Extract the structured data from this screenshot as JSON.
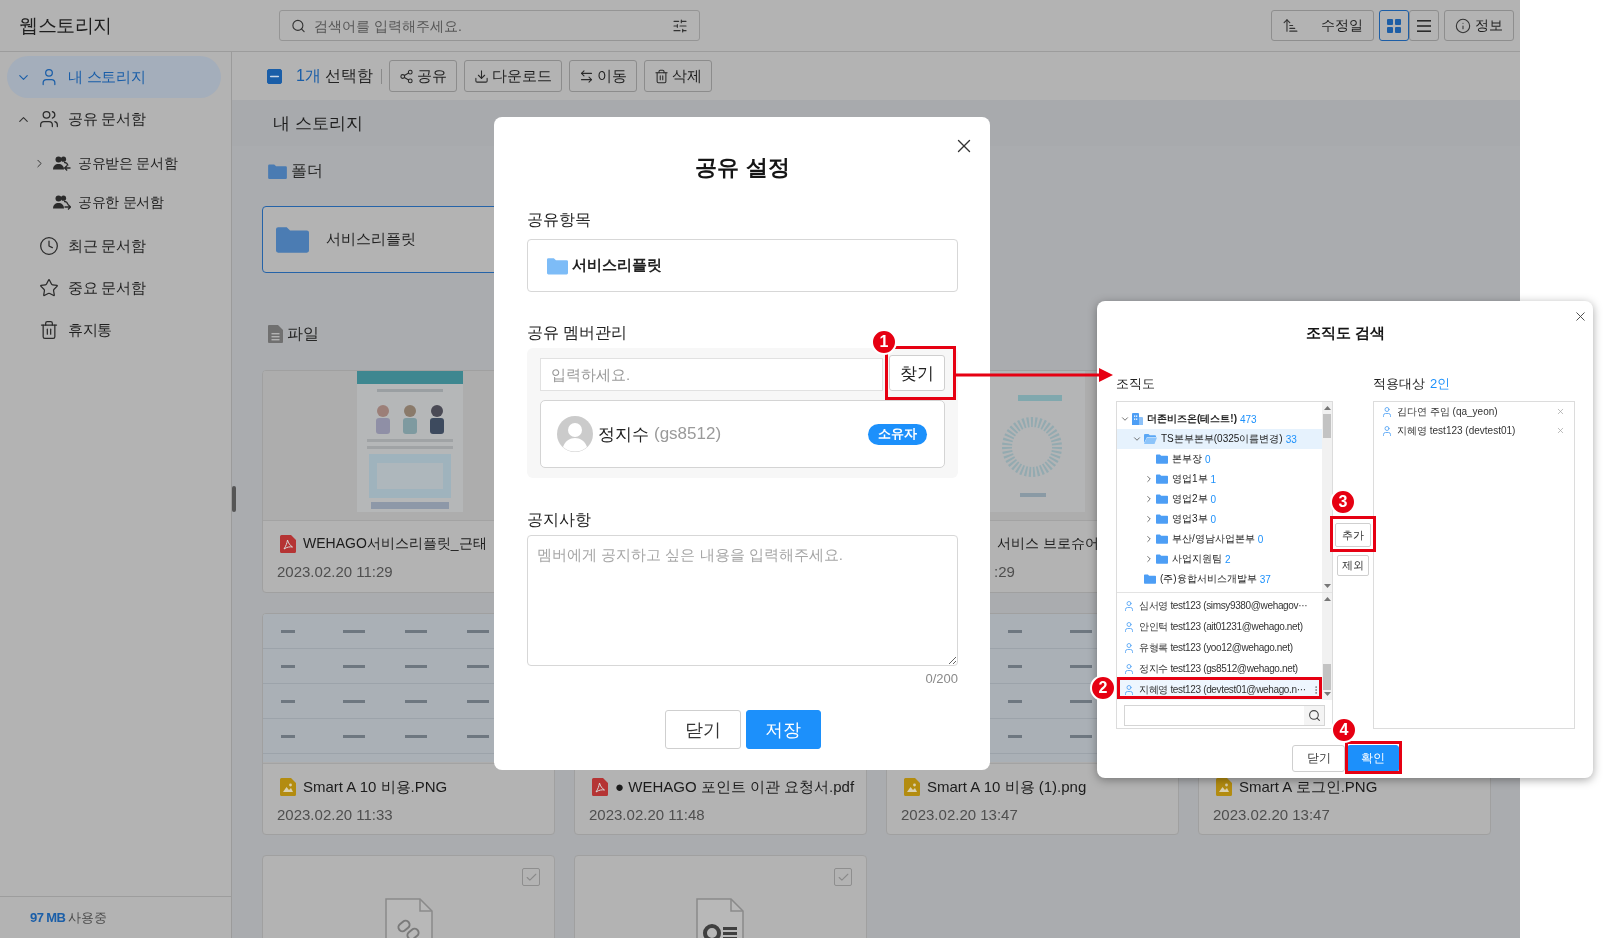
{
  "header": {
    "logo": "웹스토리지",
    "search": {
      "placeholder": "검색어를 입력해주세요."
    },
    "sort": {
      "label": "수정일"
    },
    "view_modes": [
      {
        "kind": "grid",
        "selected": true
      },
      {
        "kind": "list",
        "selected": false
      }
    ],
    "info": {
      "label": "정보"
    }
  },
  "sidebar": {
    "items": [
      {
        "kind": "storage",
        "label": "내 스토리지",
        "selected": true,
        "expanded": false
      },
      {
        "kind": "shared",
        "label": "공유 문서함",
        "selected": false,
        "expanded": true,
        "children": [
          {
            "kind": "received",
            "label": "공유받은 문서함",
            "selected": false,
            "expanded": false
          },
          {
            "kind": "sent",
            "label": "공유한 문서함",
            "selected": false
          }
        ]
      },
      {
        "kind": "recent",
        "label": "최근 문서함",
        "selected": false
      },
      {
        "kind": "important",
        "label": "중요 문서함",
        "selected": false
      },
      {
        "kind": "trash",
        "label": "휴지통",
        "selected": false
      }
    ],
    "usage": {
      "amount": "97 MB",
      "label": "사용중"
    }
  },
  "toolbar": {
    "selection": {
      "indeterminate": true,
      "count": "1개",
      "label": "선택함"
    },
    "actions": [
      {
        "kind": "share",
        "label": "공유"
      },
      {
        "kind": "download",
        "label": "다운로드"
      },
      {
        "kind": "move",
        "label": "이동"
      },
      {
        "kind": "delete",
        "label": "삭제"
      }
    ]
  },
  "breadcrumb": "내 스토리지",
  "folders": {
    "title": "폴더",
    "items": [
      {
        "name": "서비스리플릿",
        "selected": true
      }
    ]
  },
  "files": {
    "title": "파일",
    "items": [
      {
        "kind": "pdf",
        "name": "WEHAGO서비스리플릿_근태",
        "date": "2023.02.20 11:29"
      },
      {
        "name": "서비스 브로슈어",
        "date": ":29"
      },
      {
        "kind": "image",
        "name": "Smart A 10 비용.PNG",
        "date": "2023.02.20 11:33"
      },
      {
        "kind": "pdf",
        "name": "● WEHAGO 포인트 이관 요청서.pdf",
        "date": "2023.02.20 11:48"
      },
      {
        "kind": "image",
        "name": "Smart A 10 비용 (1).png",
        "date": "2023.02.20 13:47"
      },
      {
        "kind": "image",
        "name": "Smart A 로그인.PNG",
        "date": "2023.02.20 13:47"
      },
      {
        "kind": "link",
        "checked": false
      },
      {
        "kind": "document",
        "checked": false
      }
    ]
  },
  "share_dialog": {
    "title": "공유 설정",
    "item_label": "공유항목",
    "item": {
      "name": "서비스리플릿"
    },
    "members_label": "공유 멤버관리",
    "member_input": {
      "placeholder": "입력하세요."
    },
    "find_button": "찾기",
    "members": [
      {
        "name": "정지수",
        "id": "(gs8512)",
        "badge": "소유자"
      }
    ],
    "notice_label": "공지사항",
    "notice": {
      "placeholder": "멤버에게 공지하고 싶은 내용을 입력해주세요."
    },
    "counter": "0/200",
    "buttons": [
      {
        "kind": "close",
        "label": "닫기"
      },
      {
        "kind": "save",
        "label": "저장"
      }
    ]
  },
  "org_dialog": {
    "title": "조직도 검색",
    "tree_label": "조직도",
    "tree": [
      {
        "kind": "company",
        "label": "더존비즈온(테스트!)",
        "count": "473",
        "selected": false,
        "expanded": true,
        "children": [
          {
            "kind": "team",
            "label": "TS본부본부(0325이름변경)",
            "count": "33",
            "selected": true,
            "expanded": true,
            "children": [
              {
                "kind": "team",
                "label": "본부장",
                "count": "0",
                "selected": false
              },
              {
                "kind": "team",
                "label": "영업1부",
                "count": "1",
                "selected": false,
                "expanded": false
              },
              {
                "kind": "team",
                "label": "영업2부",
                "count": "0",
                "selected": false,
                "expanded": false
              },
              {
                "kind": "team",
                "label": "영업3부",
                "count": "0",
                "selected": false,
                "expanded": false
              },
              {
                "kind": "team",
                "label": "부산/영남사업본부",
                "count": "0",
                "selected": false,
                "expanded": false
              },
              {
                "kind": "team",
                "label": "사업지원팀",
                "count": "2",
                "selected": false,
                "expanded": false
              }
            ]
          },
          {
            "kind": "team",
            "label": "(주)융합서비스개발부",
            "count": "37",
            "selected": false
          }
        ]
      }
    ],
    "users": [
      {
        "name": "심서영 test123 (simsy9380@wehagov···",
        "selected": false
      },
      {
        "name": "안인턱 test123 (ait01231@wehago.net)",
        "selected": false
      },
      {
        "name": "유형록 test123 (yoo12@wehago.net)",
        "selected": false
      },
      {
        "name": "정지수 test123 (gs8512@wehago.net)",
        "selected": false
      },
      {
        "name": "지혜영 test123 (devtest01@wehago.n···",
        "selected": true
      }
    ],
    "add_button": "추가",
    "remove_button": "제외",
    "applied_label": "적용대상",
    "applied_count": "2인",
    "applied": [
      {
        "name": "김다연 주임 (qa_yeon)"
      },
      {
        "name": "지혜영 test123 (devtest01)"
      }
    ],
    "buttons": [
      {
        "kind": "close",
        "label": "닫기"
      },
      {
        "kind": "confirm",
        "label": "확인"
      }
    ]
  },
  "annotations": [
    {
      "label": "1"
    },
    {
      "label": "2"
    },
    {
      "label": "3"
    },
    {
      "label": "4"
    }
  ]
}
